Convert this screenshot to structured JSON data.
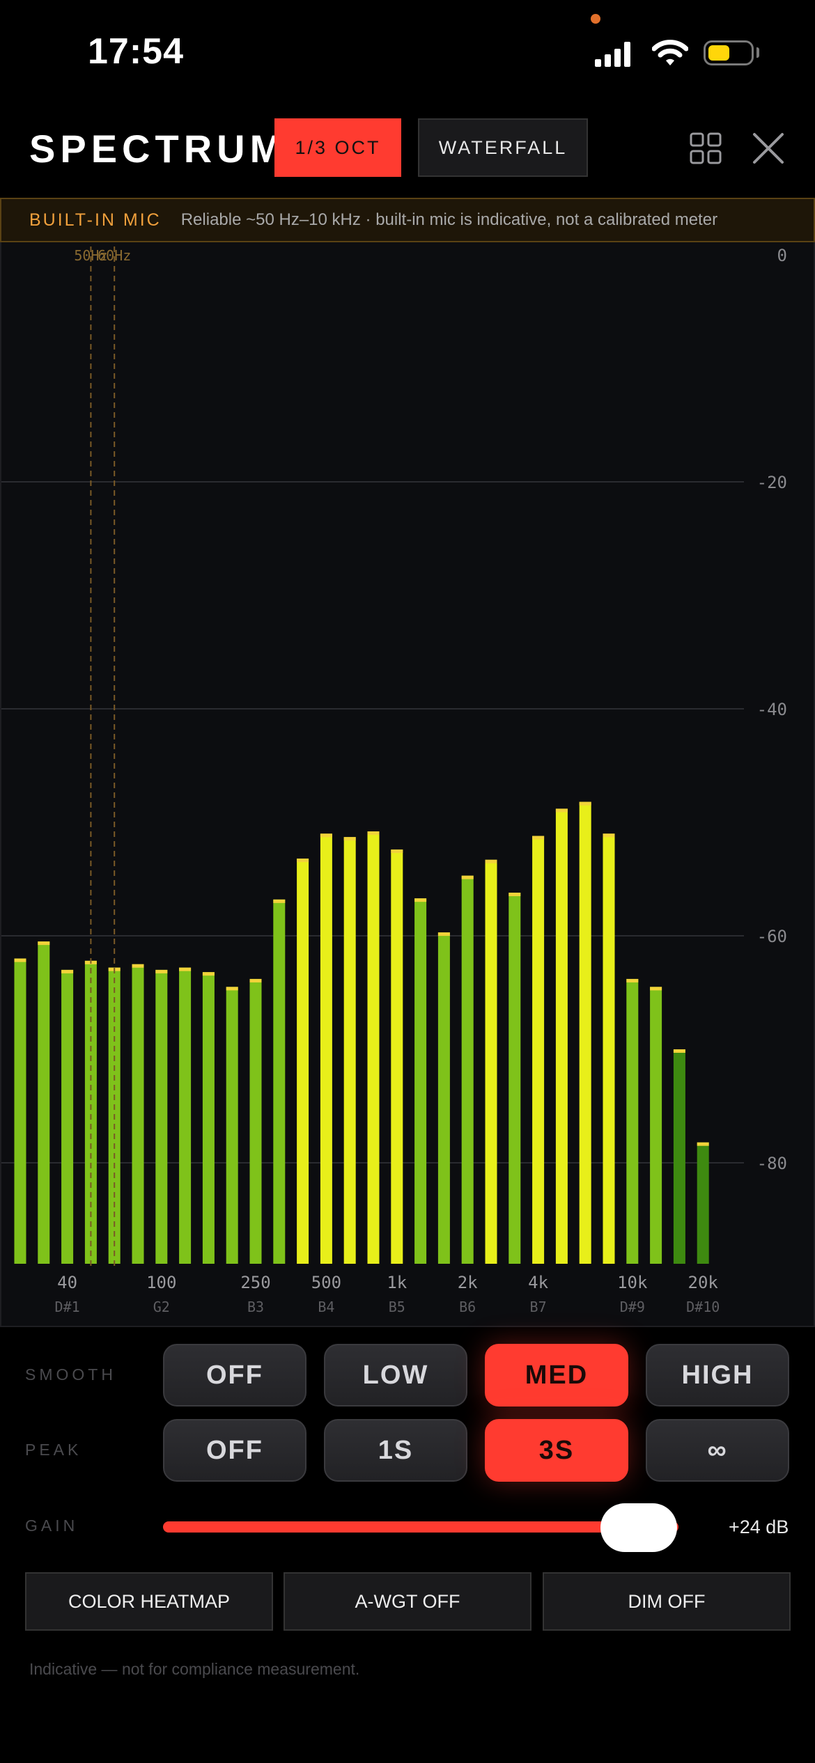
{
  "status_bar": {
    "time": "17:54"
  },
  "header": {
    "title": "SPECTRUM",
    "modes": [
      {
        "label": "1/3 OCT",
        "active": true
      },
      {
        "label": "WATERFALL",
        "active": false
      }
    ],
    "icons": [
      "grid-icon",
      "close-icon"
    ]
  },
  "banner": {
    "label": "BUILT-IN MIC",
    "note": "Reliable ~50 Hz–10 kHz · built-in mic is indicative, not a calibrated meter"
  },
  "chart_data": {
    "type": "bar",
    "ylim": [
      -90,
      0
    ],
    "y_ticks": [
      0,
      -20,
      -40,
      -60,
      -80
    ],
    "y_tick_labels": [
      "0",
      "-20",
      "-40",
      "-60",
      "-80"
    ],
    "x_ticks": [
      {
        "label": "40",
        "note": "D#1",
        "band": 2
      },
      {
        "label": "100",
        "note": "G2",
        "band": 6
      },
      {
        "label": "250",
        "note": "B3",
        "band": 10
      },
      {
        "label": "500",
        "note": "B4",
        "band": 13
      },
      {
        "label": "1k",
        "note": "B5",
        "band": 16
      },
      {
        "label": "2k",
        "note": "B6",
        "band": 19
      },
      {
        "label": "4k",
        "note": "B7",
        "band": 22
      },
      {
        "label": "10k",
        "note": "D#9",
        "band": 26
      },
      {
        "label": "20k",
        "note": "D#10",
        "band": 29
      }
    ],
    "markers": [
      {
        "label": "50Hz",
        "band": 3
      },
      {
        "label": "60Hz",
        "band": 4
      }
    ],
    "values": [
      -62,
      -60.5,
      -63,
      -62.2,
      -62.8,
      -62.5,
      -63,
      -62.8,
      -63.2,
      -64.5,
      -63.8,
      -56.8,
      -53.2,
      -51,
      -51.3,
      -50.8,
      -52.4,
      -56.7,
      -59.7,
      -54.7,
      -53.3,
      -56.2,
      -51.2,
      -48.8,
      -48.2,
      -51,
      -63.8,
      -64.5,
      -70,
      -78.2
    ],
    "colors": {
      "low": "#3e8a10",
      "mid": "#7fc21a",
      "high": "#e8ef1a",
      "cap": "#f2d33a"
    }
  },
  "controls": {
    "smooth": {
      "label": "SMOOTH",
      "options": [
        "OFF",
        "LOW",
        "MED",
        "HIGH"
      ],
      "selected": "MED"
    },
    "peak": {
      "label": "PEAK",
      "options": [
        "OFF",
        "1S",
        "3S",
        "∞"
      ],
      "selected": "3S"
    },
    "gain": {
      "label": "GAIN",
      "value_text": "+24 dB",
      "level": 0.93
    }
  },
  "options": [
    "COLOR HEATMAP",
    "A-WGT OFF",
    "DIM OFF"
  ],
  "disclaimer": "Indicative — not for compliance measurement.",
  "accent": "#ff3b30"
}
